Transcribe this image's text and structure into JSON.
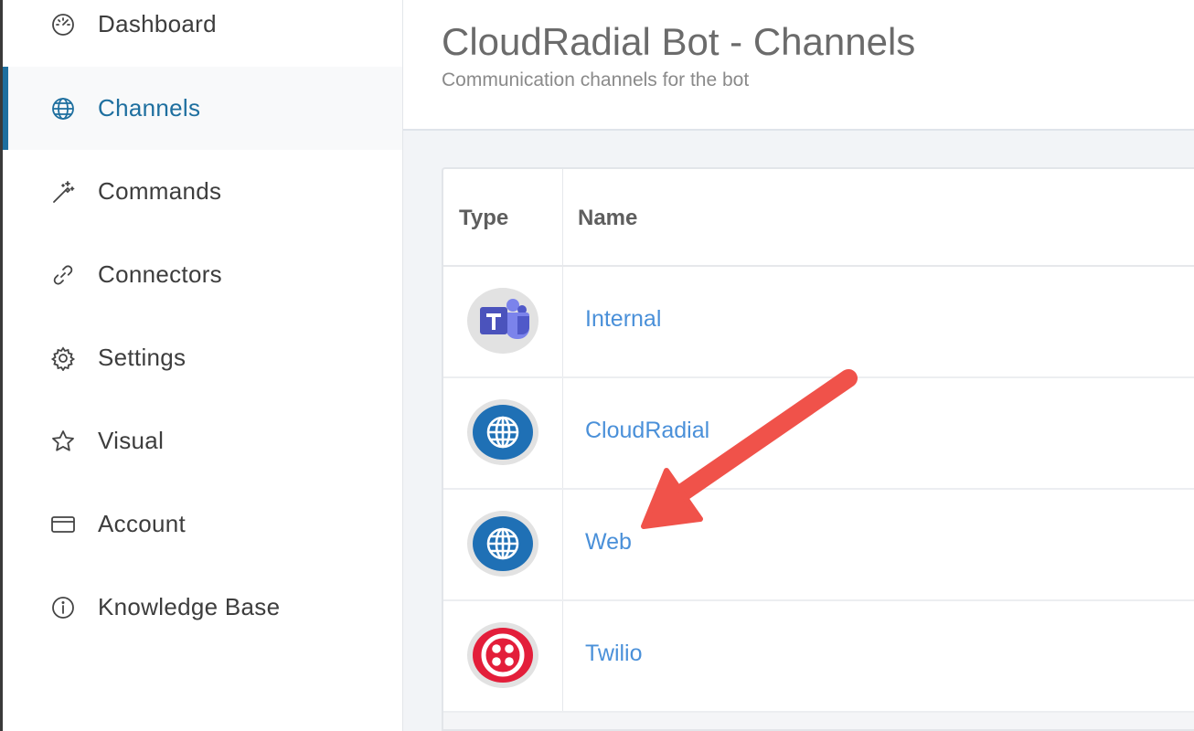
{
  "sidebar": {
    "items": [
      {
        "label": "Dashboard",
        "icon": "gauge-icon",
        "active": false
      },
      {
        "label": "Channels",
        "icon": "globe-icon",
        "active": true
      },
      {
        "label": "Commands",
        "icon": "magic-wand-icon",
        "active": false
      },
      {
        "label": "Connectors",
        "icon": "link-icon",
        "active": false
      },
      {
        "label": "Settings",
        "icon": "gear-icon",
        "active": false
      },
      {
        "label": "Visual",
        "icon": "star-icon",
        "active": false
      },
      {
        "label": "Account",
        "icon": "credit-card-icon",
        "active": false
      },
      {
        "label": "Knowledge Base",
        "icon": "info-circle-icon",
        "active": false
      }
    ]
  },
  "header": {
    "title": "CloudRadial Bot - Channels",
    "subtitle": "Communication channels for the bot"
  },
  "table": {
    "columns": [
      "Type",
      "Name"
    ],
    "rows": [
      {
        "type_icon": "teams-icon",
        "name": "Internal"
      },
      {
        "type_icon": "web-globe-icon",
        "name": "CloudRadial"
      },
      {
        "type_icon": "web-globe-icon",
        "name": "Web"
      },
      {
        "type_icon": "twilio-icon",
        "name": "Twilio"
      }
    ]
  },
  "annotation": {
    "type": "arrow",
    "points_to": "Web",
    "color": "#f0524a"
  },
  "colors": {
    "accent": "#1e6f9f",
    "link": "#4a90d9",
    "teams": "#5059c9",
    "web": "#1f70b5",
    "twilio": "#e31e3a"
  }
}
